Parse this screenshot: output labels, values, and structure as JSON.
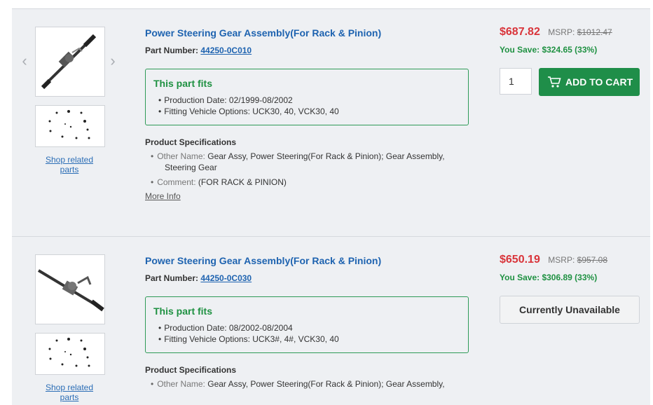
{
  "nav": {
    "prev_arrow": "‹",
    "next_arrow": "›"
  },
  "fits_heading": "This part fits",
  "spec_heading": "Product Specifications",
  "more_info": "More Info",
  "shop_related": "Shop related parts",
  "part_number_label": "Part Number:",
  "msrp_label": "MSRP:",
  "bullet": "•",
  "products": [
    {
      "title": "Power Steering Gear Assembly(For Rack & Pinion)",
      "part_number": "44250-0C010",
      "fits": [
        "Production Date: 02/1999-08/2002",
        "Fitting Vehicle Options: UCK30, 40, VCK30, 40"
      ],
      "specs": [
        {
          "label": "Other Name:",
          "value": "Gear Assy, Power Steering(For Rack & Pinion); Gear Assembly,",
          "value2": "Steering Gear"
        },
        {
          "label": "Comment:",
          "value": "(FOR RACK & PINION)"
        }
      ],
      "price": "$687.82",
      "msrp": "$1012.47",
      "you_save": "You Save: $324.65 (33%)",
      "qty": "1",
      "button": "ADD TO CART",
      "available": true
    },
    {
      "title": "Power Steering Gear Assembly(For Rack & Pinion)",
      "part_number": "44250-0C030",
      "fits": [
        "Production Date: 08/2002-08/2004",
        "Fitting Vehicle Options: UCK3#, 4#, VCK30, 40"
      ],
      "specs": [
        {
          "label": "Other Name:",
          "value": "Gear Assy, Power Steering(For Rack & Pinion); Gear Assembly,"
        }
      ],
      "price": "$650.19",
      "msrp": "$957.08",
      "you_save": "You Save: $306.89 (33%)",
      "button": "Currently Unavailable",
      "available": false
    }
  ],
  "colors": {
    "price": "#d9343a",
    "save": "#1f9142",
    "link": "#1e63b0",
    "button": "#1f8e49"
  }
}
